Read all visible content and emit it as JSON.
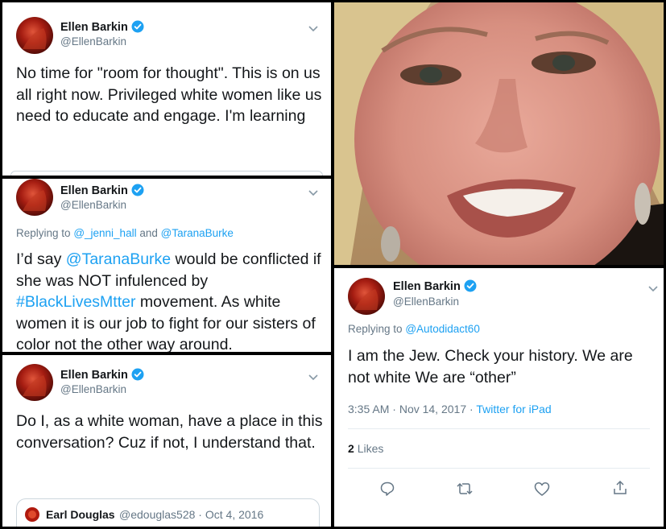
{
  "colors": {
    "link": "#1da1f2",
    "muted": "#657786",
    "text": "#14171a",
    "verified": "#1da1f2"
  },
  "icons": [
    "avatar",
    "verified-badge-icon",
    "chevron-down-icon",
    "reply-icon",
    "retweet-icon",
    "like-icon",
    "share-icon"
  ],
  "tweets": [
    {
      "name": "Ellen Barkin",
      "handle": "@EllenBarkin",
      "text": "No time for \"room for thought\". This is on us all right now. Privileged white women like us need to educate and engage. I'm learning"
    },
    {
      "name": "Ellen Barkin",
      "handle": "@EllenBarkin",
      "replying_label": "Replying to",
      "replying_to_1": "@_jenni_hall",
      "replying_and": "and",
      "replying_to_2": "@TaranaBurke",
      "text_pre": "I’d say ",
      "mention": "@TaranaBurke",
      "text_mid": " would be conflicted if she was NOT infulenced by ",
      "hashtag": "#BlackLivesMtter",
      "text_post": " movement. As white women it is our job to fight for our sisters of color not the other way around."
    },
    {
      "name": "Ellen Barkin",
      "handle": "@EllenBarkin",
      "text": "Do I, as a white woman, have a place in this conversation? Cuz if not, I understand that.",
      "quote": {
        "name": "Earl Douglas",
        "handle": "@edouglas528",
        "sep": "·",
        "date": "Oct 4, 2016"
      }
    },
    {
      "name": "Ellen Barkin",
      "handle": "@EllenBarkin",
      "replying_label": "Replying to",
      "replying_to": "@Autodidact60",
      "text": "I am the Jew. Check your history. We are not white We are “other”",
      "time": "3:35 AM",
      "sep": "·",
      "date": "Nov 14, 2017",
      "sep2": "·",
      "source": "Twitter for iPad",
      "likes_count": "2",
      "likes_label": "Likes"
    }
  ]
}
